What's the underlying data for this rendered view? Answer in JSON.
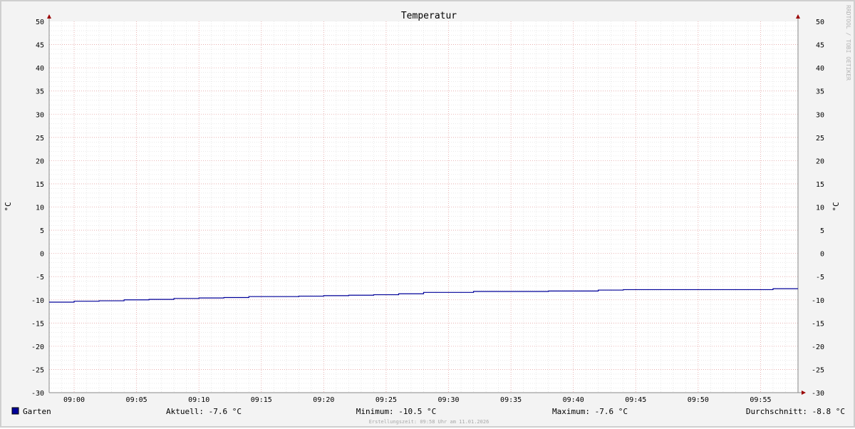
{
  "chart_data": {
    "type": "line",
    "title": "Temperatur",
    "ylabel": "°C",
    "ylabel_right": "°C",
    "ylim": [
      -30,
      50
    ],
    "yticks": [
      50,
      45,
      40,
      35,
      30,
      25,
      20,
      15,
      10,
      5,
      0,
      -5,
      -10,
      -15,
      -20,
      -25,
      -30
    ],
    "xlim": [
      "08:58",
      "09:58"
    ],
    "xticks": [
      "09:00",
      "09:05",
      "09:10",
      "09:15",
      "09:20",
      "09:25",
      "09:30",
      "09:35",
      "09:40",
      "09:45",
      "09:50",
      "09:55"
    ],
    "grid": true,
    "watermark": "RRDTOOL / TOBI OETIKER",
    "series": [
      {
        "name": "Garten",
        "color": "#000099",
        "step": true,
        "x": [
          "08:58",
          "09:00",
          "09:02",
          "09:04",
          "09:06",
          "09:08",
          "09:10",
          "09:12",
          "09:14",
          "09:16",
          "09:18",
          "09:20",
          "09:22",
          "09:24",
          "09:26",
          "09:28",
          "09:30",
          "09:32",
          "09:34",
          "09:36",
          "09:38",
          "09:40",
          "09:42",
          "09:44",
          "09:46",
          "09:48",
          "09:50",
          "09:52",
          "09:54",
          "09:56",
          "09:58"
        ],
        "y": [
          -10.5,
          -10.3,
          -10.2,
          -10.0,
          -9.9,
          -9.7,
          -9.6,
          -9.5,
          -9.3,
          -9.3,
          -9.2,
          -9.1,
          -9.0,
          -8.9,
          -8.7,
          -8.4,
          -8.4,
          -8.2,
          -8.2,
          -8.2,
          -8.1,
          -8.1,
          -7.9,
          -7.8,
          -7.8,
          -7.8,
          -7.8,
          -7.8,
          -7.8,
          -7.6,
          -7.6
        ]
      }
    ]
  },
  "legend": {
    "series_name": "Garten",
    "swatch_color": "#000099",
    "current": "Aktuell: -7.6 °C",
    "minimum": "Minimum: -10.5 °C",
    "maximum": "Maximum: -7.6 °C",
    "average": "Durchschnitt: -8.8 °C"
  },
  "footer": "Erstellungszeit: 09:58 Uhr am 11.01.2026"
}
